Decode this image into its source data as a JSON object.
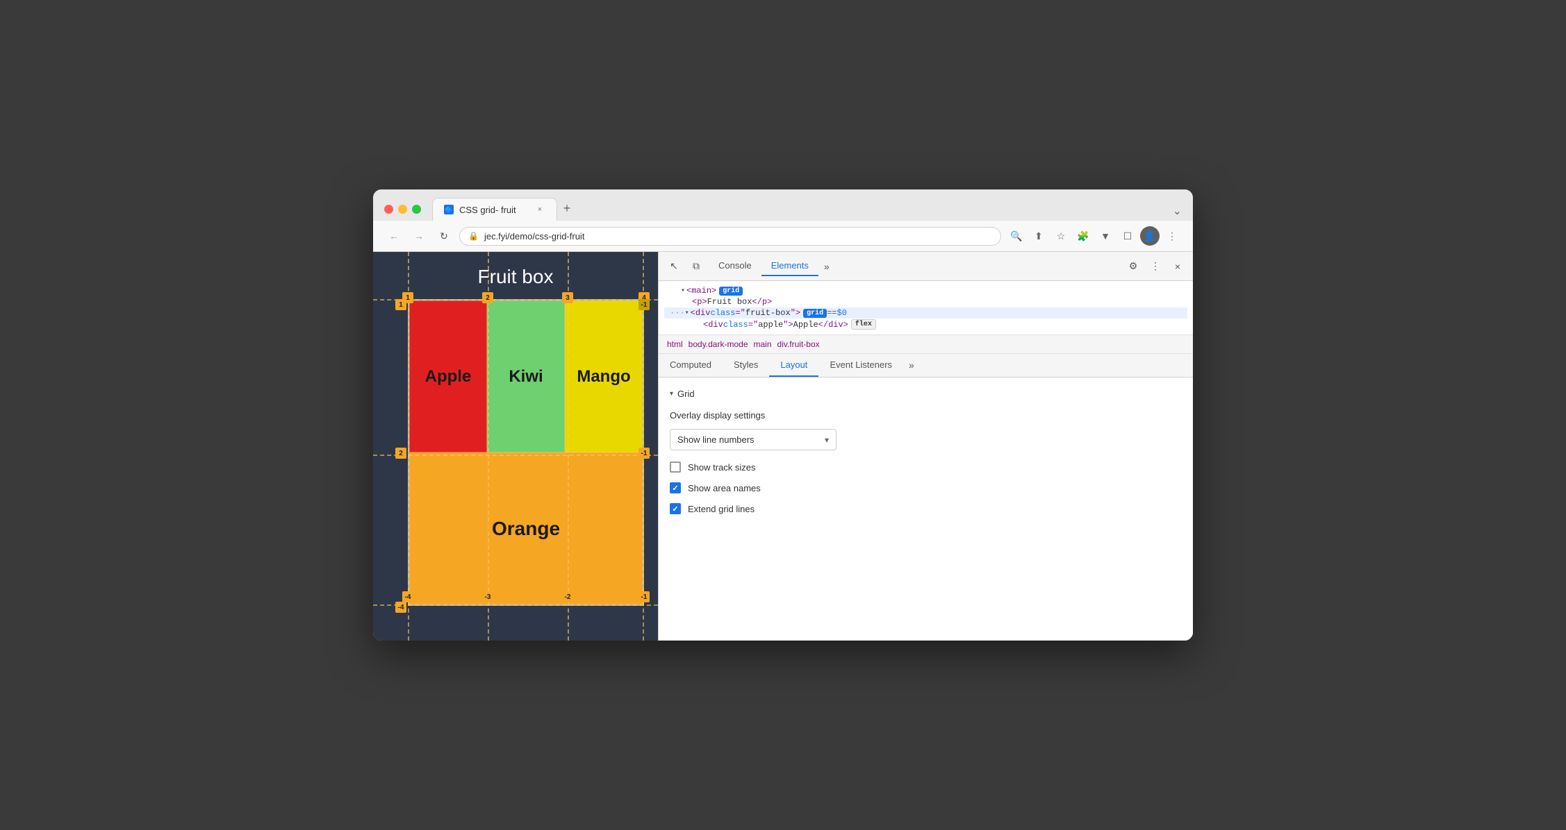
{
  "browser": {
    "traffic_lights": [
      "red",
      "yellow",
      "green"
    ],
    "tab": {
      "favicon": "🔷",
      "title": "CSS grid- fruit",
      "close": "×"
    },
    "new_tab": "+",
    "chevron": "⌄",
    "back": "←",
    "forward": "→",
    "refresh": "↻",
    "address": "jec.fyi/demo/css-grid-fruit",
    "toolbar_icons": [
      "🔍",
      "⬆",
      "☆",
      "🧩",
      "▼",
      "☐",
      "👤",
      "⋮"
    ]
  },
  "web_preview": {
    "title": "Fruit box",
    "fruits": [
      {
        "name": "Apple",
        "color": "#e02020",
        "class": "apple"
      },
      {
        "name": "Kiwi",
        "color": "#6ed06e",
        "class": "kiwi"
      },
      {
        "name": "Mango",
        "color": "#e8d800",
        "class": "mango"
      },
      {
        "name": "Orange",
        "color": "#f5a623",
        "class": "orange"
      }
    ]
  },
  "devtools": {
    "toolbar": {
      "cursor_icon": "↖",
      "copy_icon": "⧉",
      "tabs": [
        "Console",
        "Elements",
        "»"
      ],
      "active_tab": "Elements",
      "settings_icon": "⚙",
      "more_icon": "⋮",
      "close_icon": "×"
    },
    "dom": {
      "lines": [
        {
          "indent": 0,
          "content": "▾ <main>",
          "badge": "grid",
          "badge_class": "badge-grid"
        },
        {
          "indent": 1,
          "content": "<p>Fruit box</p>"
        },
        {
          "indent": 0,
          "content": "▾ <div class=\"fruit-box\">",
          "badge": "grid",
          "badge_class": "badge-grid",
          "eq": "== $0",
          "selected": true
        },
        {
          "indent": 1,
          "content": "<div class=\"apple\">Apple</div>",
          "badge": "flex",
          "badge_class": "badge-flex"
        }
      ]
    },
    "breadcrumb": [
      "html",
      "body.dark-mode",
      "main",
      "div.fruit-box"
    ],
    "panel_tabs": [
      "Computed",
      "Styles",
      "Layout",
      "Event Listeners",
      "»"
    ],
    "active_panel_tab": "Layout",
    "layout": {
      "section": "Grid",
      "subsection": "Overlay display settings",
      "dropdown": {
        "label": "Show line numbers",
        "arrow": "▾"
      },
      "checkboxes": [
        {
          "label": "Show track sizes",
          "checked": false
        },
        {
          "label": "Show area names",
          "checked": true
        },
        {
          "label": "Extend grid lines",
          "checked": true
        }
      ]
    }
  }
}
